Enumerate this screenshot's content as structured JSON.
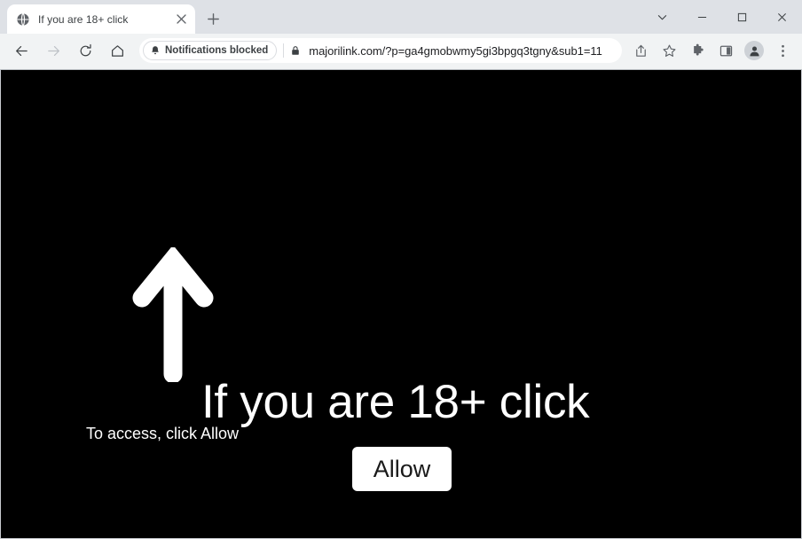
{
  "window": {
    "controls": [
      {
        "name": "tab-search",
        "icon": "chevron-down-icon",
        "label": "∨"
      },
      {
        "name": "minimize",
        "icon": "minimize-icon",
        "label": "−"
      },
      {
        "name": "maximize",
        "icon": "maximize-icon",
        "label": "□"
      },
      {
        "name": "close",
        "icon": "close-icon",
        "label": "×"
      }
    ]
  },
  "tabstrip": {
    "tabs": [
      {
        "title": "If you are 18+ click",
        "favicon": "globe-icon",
        "close_label": "×",
        "active": true
      }
    ],
    "new_tab_label": "+"
  },
  "toolbar": {
    "back_label": "←",
    "forward_label": "→",
    "reload_label": "↻",
    "home_label": "⌂",
    "notifications_chip": "Notifications blocked",
    "url": "majorilink.com/?p=ga4gmobwmy5gi3bpgq3tgny&sub1=11",
    "url_domain": "majorilink.com",
    "url_path": "/?p=ga4gmobwmy5gi3bpgq3tgny&sub1=11",
    "actions": [
      {
        "name": "share-icon",
        "label": "share"
      },
      {
        "name": "bookmark-star-icon",
        "label": "bookmark"
      },
      {
        "name": "extensions-puzzle-icon",
        "label": "extensions"
      },
      {
        "name": "side-panel-icon",
        "label": "side panel"
      },
      {
        "name": "profile-avatar-icon",
        "label": "profile"
      },
      {
        "name": "three-dot-menu-icon",
        "label": "menu"
      }
    ]
  },
  "page": {
    "background_color": "#000000",
    "text_color": "#ffffff",
    "arrow": "up-arrow-icon",
    "headline": "If you are 18+ click",
    "subtext": "To access, click Allow",
    "allow_button": "Allow",
    "allow_button_bg": "#ffffff",
    "allow_button_color": "#1a1a1a"
  }
}
